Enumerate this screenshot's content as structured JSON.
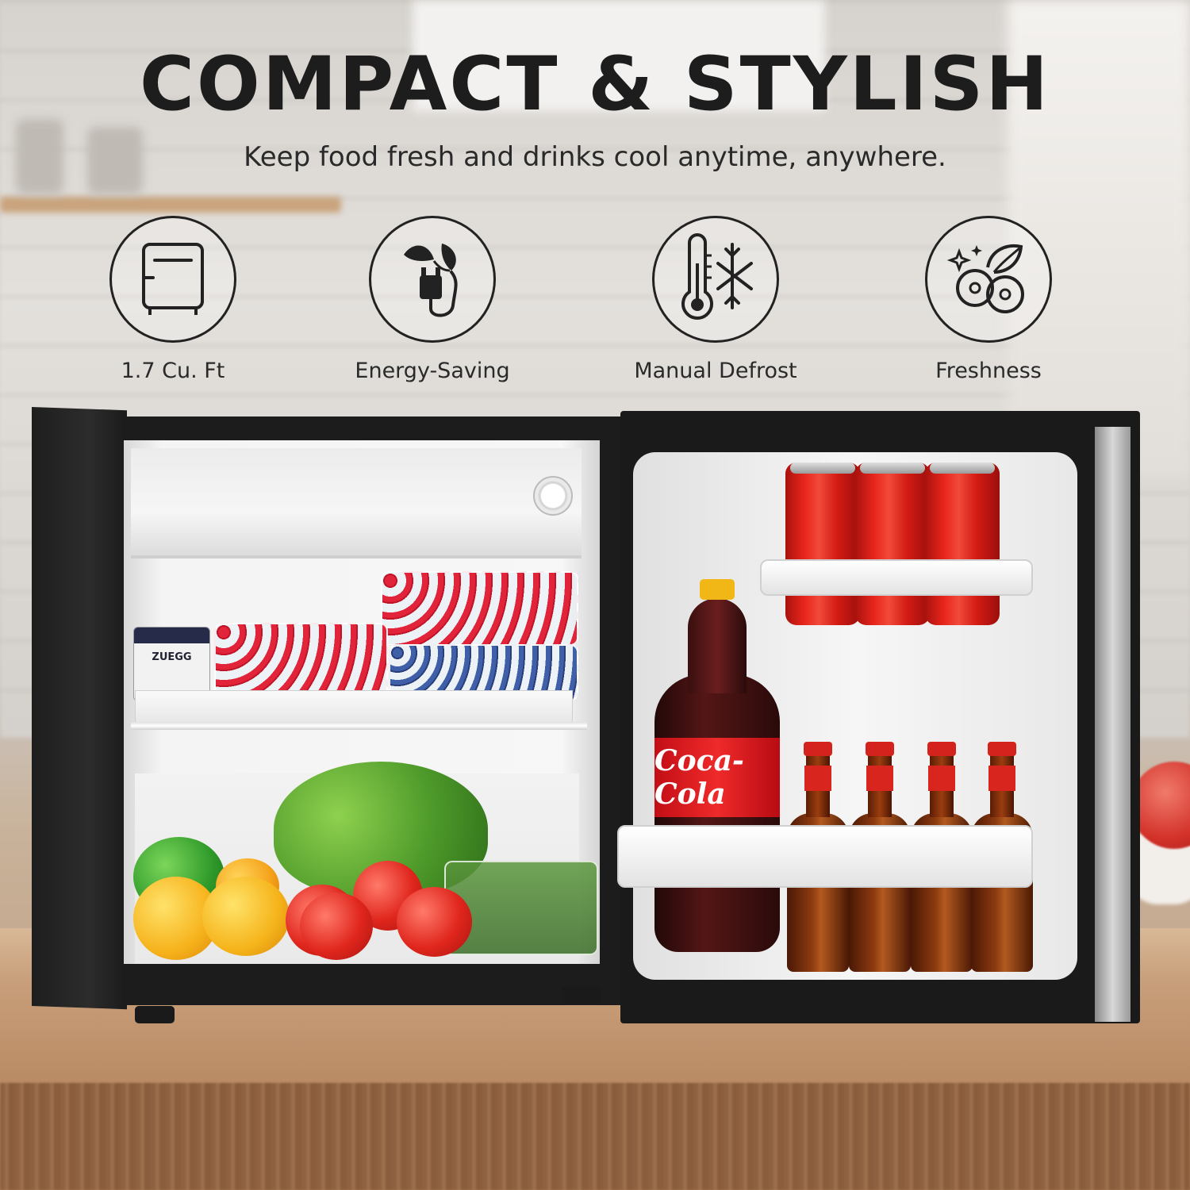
{
  "header": {
    "title": "COMPACT & STYLISH",
    "subtitle": "Keep food fresh and drinks cool anytime, anywhere."
  },
  "features": [
    {
      "label": "1.7 Cu. Ft",
      "icon": "mini-fridge-icon"
    },
    {
      "label": "Energy-Saving",
      "icon": "eco-plug-icon"
    },
    {
      "label": "Manual Defrost",
      "icon": "thermometer-snowflake-icon"
    },
    {
      "label": "Freshness",
      "icon": "fresh-fruit-icon"
    }
  ],
  "product": {
    "jar_label": "ZUEGG",
    "bottle_label": "Coca-Cola"
  },
  "colors": {
    "text": "#1d1d1d",
    "fridge_body": "#1c1c1c",
    "can_red": "#e7251c"
  }
}
